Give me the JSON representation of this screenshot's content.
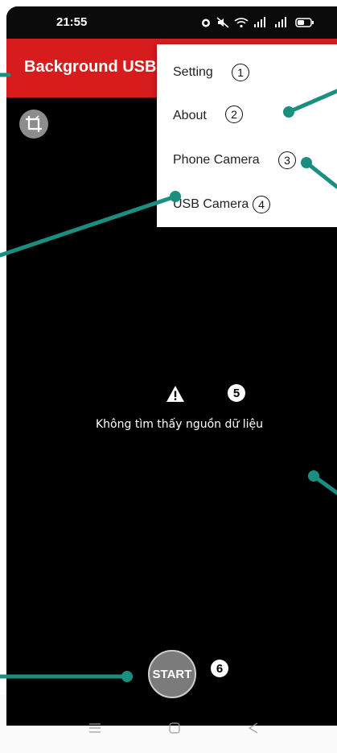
{
  "status_bar": {
    "time": "21:55"
  },
  "app_bar": {
    "title": "Background USB"
  },
  "menu": {
    "items": [
      {
        "label": "Setting",
        "number": "1"
      },
      {
        "label": "About",
        "number": "2"
      },
      {
        "label": "Phone Camera",
        "number": "3"
      },
      {
        "label": "USB Camera",
        "number": "4"
      }
    ]
  },
  "empty_state": {
    "message": "Không tìm thấy nguồn dữ liệu",
    "number": "5"
  },
  "start": {
    "label": "START",
    "number": "6"
  },
  "colors": {
    "app_bar": "#d61c1c",
    "pointer": "#1a8f80",
    "background": "#000000"
  },
  "icons": [
    "crop-icon",
    "warning-icon",
    "menu-lines-icon",
    "home-square-icon",
    "back-triangle-icon"
  ]
}
